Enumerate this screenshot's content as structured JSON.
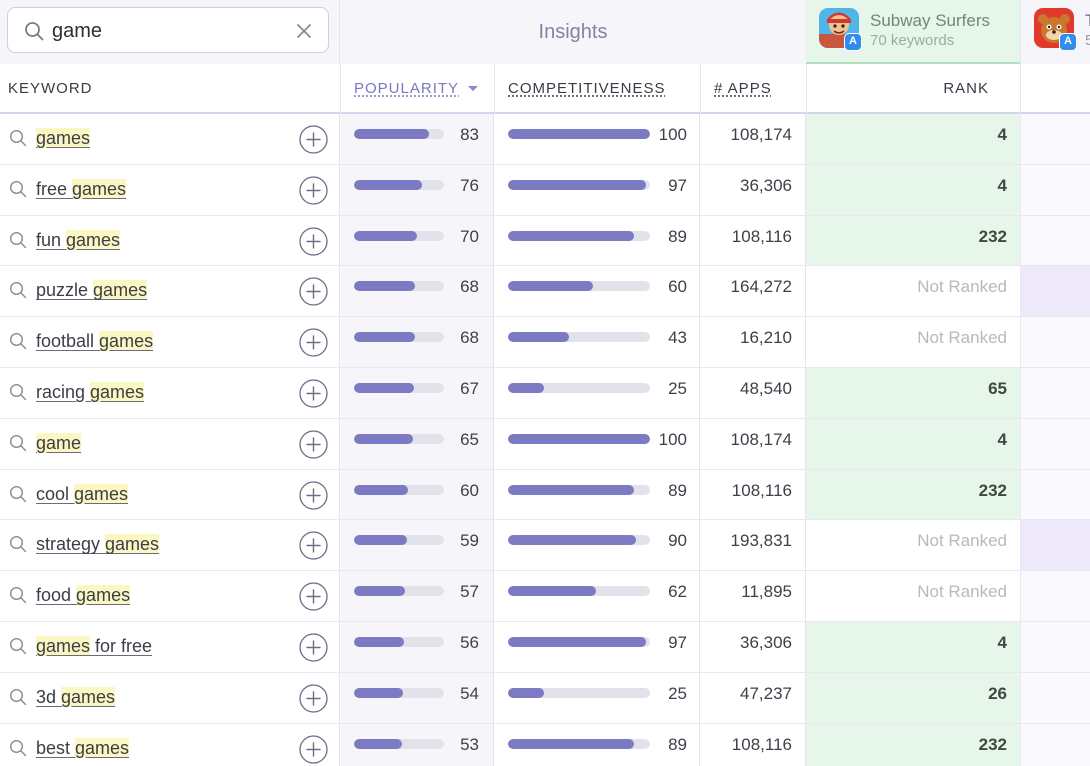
{
  "search": {
    "value": "game",
    "placeholder": ""
  },
  "header": {
    "insights_label": "Insights",
    "app1": {
      "name": "Subway Surfers",
      "keywords": "70 keywords",
      "icon": "subway-surfers-app-icon",
      "store_badge": "app-store-badge"
    },
    "app2": {
      "name": "T",
      "keywords": "5",
      "icon": "talking-tom-app-icon",
      "store_badge": "app-store-badge"
    }
  },
  "columns": {
    "keyword": "KEYWORD",
    "popularity": "POPULARITY",
    "competitiveness": "COMPETITIVENESS",
    "apps": "# APPS",
    "rank": "RANK"
  },
  "colors": {
    "bar_fill": "#7c7ac2",
    "bar_track": "#e2e2ea",
    "ranked_bg": "#e7f6ea",
    "highlight": "#fbf7c2"
  },
  "rows": [
    {
      "pre": "",
      "match": "games",
      "post": "",
      "popularity": "83",
      "competitiveness": "100",
      "apps": "108,174",
      "rank": "4",
      "ranked": true,
      "next_tint": false
    },
    {
      "pre": "free ",
      "match": "games",
      "post": "",
      "popularity": "76",
      "competitiveness": "97",
      "apps": "36,306",
      "rank": "4",
      "ranked": true,
      "next_tint": false
    },
    {
      "pre": "fun ",
      "match": "games",
      "post": "",
      "popularity": "70",
      "competitiveness": "89",
      "apps": "108,116",
      "rank": "232",
      "ranked": true,
      "next_tint": false
    },
    {
      "pre": "puzzle ",
      "match": "games",
      "post": "",
      "popularity": "68",
      "competitiveness": "60",
      "apps": "164,272",
      "rank": "Not Ranked",
      "ranked": false,
      "next_tint": true
    },
    {
      "pre": "football ",
      "match": "games",
      "post": "",
      "popularity": "68",
      "competitiveness": "43",
      "apps": "16,210",
      "rank": "Not Ranked",
      "ranked": false,
      "next_tint": false
    },
    {
      "pre": "racing ",
      "match": "games",
      "post": "",
      "popularity": "67",
      "competitiveness": "25",
      "apps": "48,540",
      "rank": "65",
      "ranked": true,
      "next_tint": false
    },
    {
      "pre": "",
      "match": "game",
      "post": "",
      "popularity": "65",
      "competitiveness": "100",
      "apps": "108,174",
      "rank": "4",
      "ranked": true,
      "next_tint": false
    },
    {
      "pre": "cool ",
      "match": "games",
      "post": "",
      "popularity": "60",
      "competitiveness": "89",
      "apps": "108,116",
      "rank": "232",
      "ranked": true,
      "next_tint": false
    },
    {
      "pre": "strategy ",
      "match": "games",
      "post": "",
      "popularity": "59",
      "competitiveness": "90",
      "apps": "193,831",
      "rank": "Not Ranked",
      "ranked": false,
      "next_tint": true
    },
    {
      "pre": "food ",
      "match": "games",
      "post": "",
      "popularity": "57",
      "competitiveness": "62",
      "apps": "11,895",
      "rank": "Not Ranked",
      "ranked": false,
      "next_tint": false
    },
    {
      "pre": "",
      "match": "games",
      "post": " for free",
      "popularity": "56",
      "competitiveness": "97",
      "apps": "36,306",
      "rank": "4",
      "ranked": true,
      "next_tint": false
    },
    {
      "pre": "3d ",
      "match": "games",
      "post": "",
      "popularity": "54",
      "competitiveness": "25",
      "apps": "47,237",
      "rank": "26",
      "ranked": true,
      "next_tint": false
    },
    {
      "pre": "best ",
      "match": "games",
      "post": "",
      "popularity": "53",
      "competitiveness": "89",
      "apps": "108,116",
      "rank": "232",
      "ranked": true,
      "next_tint": false
    }
  ]
}
